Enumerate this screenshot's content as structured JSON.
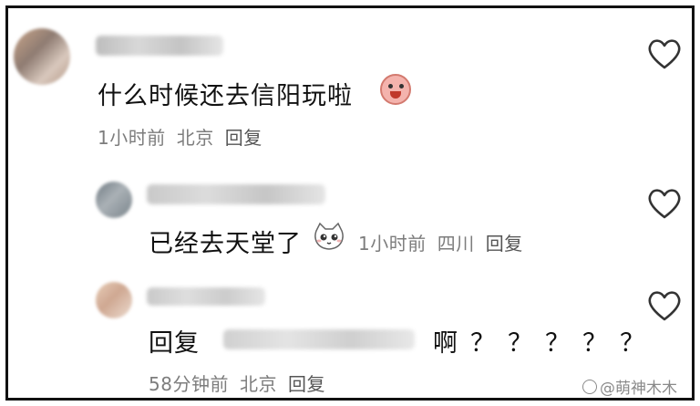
{
  "comments": [
    {
      "text": "什么时候还去信阳玩啦",
      "time": "1小时前",
      "location": "北京",
      "reply_label": "回复"
    },
    {
      "text": "已经去天堂了",
      "time": "1小时前",
      "location": "四川",
      "reply_label": "回复"
    },
    {
      "reply_prefix": "回复",
      "text": "啊？？？？？",
      "time": "58分钟前",
      "location": "北京",
      "reply_label": "回复"
    }
  ],
  "watermark": "@萌神木木"
}
